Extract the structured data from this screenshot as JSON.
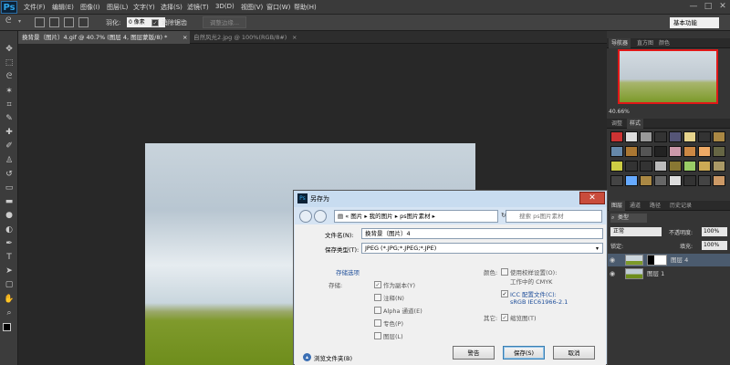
{
  "app": {
    "logo": "Ps"
  },
  "menubar": {
    "items": [
      "文件(F)",
      "编辑(E)",
      "图像(I)",
      "图层(L)",
      "文字(Y)",
      "选择(S)",
      "滤镜(T)",
      "3D(D)",
      "视图(V)",
      "窗口(W)",
      "帮助(H)"
    ],
    "window_controls": [
      "—",
      "□",
      "✕"
    ]
  },
  "options_bar": {
    "feather_label": "羽化:",
    "feather_value": "0 像素",
    "antialias_label": "消除锯齿",
    "refine_edge_label": "调整边缘...",
    "workspace_value": "基本功能"
  },
  "doc_tabs": [
    {
      "label": "换背景（图片）4.gif @ 40.7% (图层 4, 图层蒙版/8) *",
      "close": "×",
      "active": true
    },
    {
      "label": "自然风光2.jpg @ 100%(RGB/8#)",
      "close": "×",
      "active": false
    }
  ],
  "tools": [
    "move",
    "marquee",
    "lasso",
    "magic-wand",
    "crop",
    "eyedropper",
    "healing",
    "brush",
    "stamp",
    "history-brush",
    "eraser",
    "gradient",
    "blur",
    "dodge",
    "pen",
    "type",
    "path-select",
    "shape",
    "hand",
    "zoom"
  ],
  "panels": {
    "navigator_tabs": [
      "导航器",
      "直方图",
      "颜色"
    ],
    "zoom": "40.66%",
    "styles_tabs": [
      "调整",
      "样式"
    ],
    "layers_tabs": [
      "图层",
      "通道",
      "路径",
      "历史记录"
    ],
    "kind_label": "类型",
    "blend_mode": "正常",
    "opacity_label": "不透明度:",
    "opacity_value": "100%",
    "lock_label": "锁定:",
    "fill_label": "填充:",
    "fill_value": "100%",
    "layers": [
      {
        "name": "图层 4",
        "selected": true
      },
      {
        "name": "图层 1",
        "selected": false
      }
    ]
  },
  "dialog": {
    "title": "另存为",
    "close": "✕",
    "breadcrumb": [
      "图片",
      "我的图片",
      "ps图片素材"
    ],
    "search_placeholder": "搜索 ps图片素材",
    "filename_label": "文件名(N):",
    "filename_value": "换背景（图片）4",
    "format_label": "保存类型(T):",
    "format_value": "JPEG (*.JPG;*.JPEG;*.JPE)",
    "save_options_title": "存储选项",
    "save_label": "存储:",
    "opt_copy": "作为副本(Y)",
    "opt_notes": "注释(N)",
    "opt_alpha": "Alpha 通道(E)",
    "opt_spot": "专色(P)",
    "opt_layers": "图层(L)",
    "color_label": "颜色:",
    "opt_proof_1": "使用校样设置(O):",
    "opt_proof_2": "工作中的 CMYK",
    "opt_icc_1": "ICC 配置文件(C):",
    "opt_icc_2": "sRGB IEC61966-2.1",
    "other_label": "其它:",
    "opt_thumb": "缩览图(T)",
    "browse_label": "浏览文件夹(B)",
    "btn_warning": "警告",
    "btn_save": "保存(S)",
    "btn_cancel": "取消"
  },
  "colors": {
    "accent_close": "#c94c3c",
    "nav_highlight": "#e01818"
  }
}
